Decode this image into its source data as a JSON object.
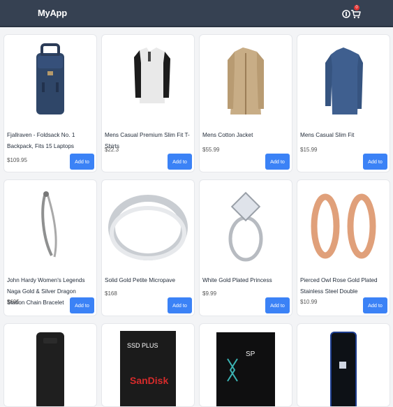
{
  "app": {
    "title": "MyApp",
    "cart_count": "0"
  },
  "icons": {
    "user": "user-icon",
    "cart": "cart-icon"
  },
  "colors": {
    "navbar": "#364152",
    "button": "#3b82f6",
    "badge": "#e03131"
  },
  "products": [
    {
      "title": "Fjallraven - Foldsack No. 1 Backpack, Fits 15 Laptops",
      "price": "$109.95",
      "button": "Add to Cart"
    },
    {
      "title": "Mens Casual Premium Slim Fit T-Shirts",
      "price": "$22.3",
      "button": "Add to Cart"
    },
    {
      "title": "Mens Cotton Jacket",
      "price": "$55.99",
      "button": "Add to Cart"
    },
    {
      "title": "Mens Casual Slim Fit",
      "price": "$15.99",
      "button": "Add to Cart"
    },
    {
      "title": "John Hardy Women's Legends Naga Gold & Silver Dragon Station Chain Bracelet",
      "price": "$695",
      "button": "Add to Cart"
    },
    {
      "title": "Solid Gold Petite Micropave",
      "price": "$168",
      "button": "Add to Cart"
    },
    {
      "title": "White Gold Plated Princess",
      "price": "$9.99",
      "button": "Add to Cart"
    },
    {
      "title": "Pierced Owl Rose Gold Plated Stainless Steel Double",
      "price": "$10.99",
      "button": "Add to Cart"
    },
    {
      "image_text": ""
    },
    {
      "image_text": "SanDisk"
    },
    {
      "image_text": "SP"
    },
    {
      "image_text": ""
    }
  ]
}
